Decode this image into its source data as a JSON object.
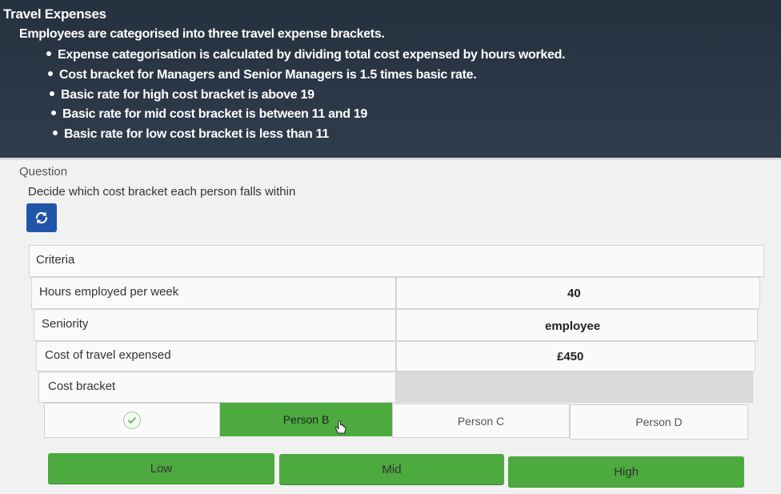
{
  "header": {
    "title": "Travel Expenses",
    "intro": "Employees are categorised into three travel expense brackets.",
    "bullets": [
      "Expense categorisation is calculated by dividing total cost expensed by hours worked.",
      "Cost bracket for Managers and Senior Managers is 1.5 times basic rate.",
      "Basic rate for high cost bracket is above 19",
      "Basic rate for mid cost bracket is between 11 and 19",
      "Basic rate for low cost bracket is less than 11"
    ]
  },
  "question": {
    "label": "Question",
    "text": "Decide which cost bracket each person falls within"
  },
  "table": {
    "criteria_label": "Criteria",
    "rows": [
      {
        "label": "Hours employed per week",
        "value": "40"
      },
      {
        "label": "Seniority",
        "value": "employee"
      },
      {
        "label": "Cost of travel expensed",
        "value": "£450"
      },
      {
        "label": "Cost bracket",
        "value": ""
      }
    ]
  },
  "persons": [
    {
      "label": "",
      "state": "completed"
    },
    {
      "label": "Person B",
      "state": "selected"
    },
    {
      "label": "Person C",
      "state": "default"
    },
    {
      "label": "Person D",
      "state": "default"
    }
  ],
  "brackets": [
    "Low",
    "Mid",
    "High"
  ],
  "colors": {
    "header_bg": "#2b3645",
    "accent_green": "#4caa3f",
    "reset_blue": "#1f56a8"
  },
  "icons": {
    "reset": "refresh-icon",
    "check": "check-icon",
    "cursor": "hand-pointer-icon"
  }
}
